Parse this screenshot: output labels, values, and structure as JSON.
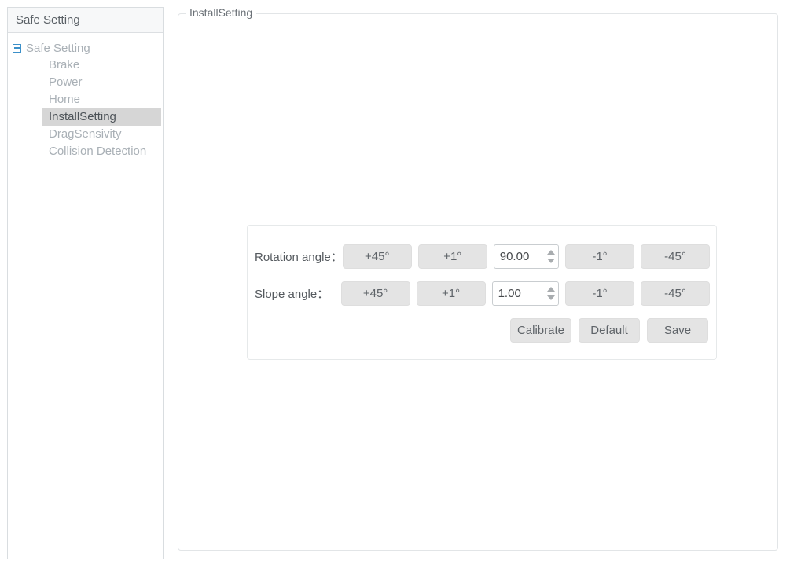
{
  "sidebar": {
    "header_title": "Safe Setting",
    "tree": {
      "root_label": "Safe Setting",
      "toggle_icon": "minus-box-icon",
      "items": [
        {
          "label": "Brake",
          "selected": false
        },
        {
          "label": "Power",
          "selected": false
        },
        {
          "label": "Home",
          "selected": false
        },
        {
          "label": "InstallSetting",
          "selected": true
        },
        {
          "label": "DragSensivity",
          "selected": false
        },
        {
          "label": "Collision Detection",
          "selected": false
        }
      ]
    }
  },
  "main": {
    "legend": "InstallSetting",
    "form": {
      "rows": [
        {
          "label": "Rotation angle：",
          "plus45_label": "+45°",
          "plus1_label": "+1°",
          "value": "90.00",
          "minus1_label": "-1°",
          "minus45_label": "-45°"
        },
        {
          "label": "Slope angle：",
          "plus45_label": "+45°",
          "plus1_label": "+1°",
          "value": "1.00",
          "minus1_label": "-1°",
          "minus45_label": "-45°"
        }
      ],
      "actions": {
        "calibrate_label": "Calibrate",
        "default_label": "Default",
        "save_label": "Save"
      }
    }
  },
  "colors": {
    "selected_row_bg": "#d6d6d6",
    "tree_text": "#a9b0b6",
    "button_bg": "#e4e4e4",
    "toggle_icon_blue": "#3c90c9",
    "panel_border": "#e2e5e7"
  }
}
